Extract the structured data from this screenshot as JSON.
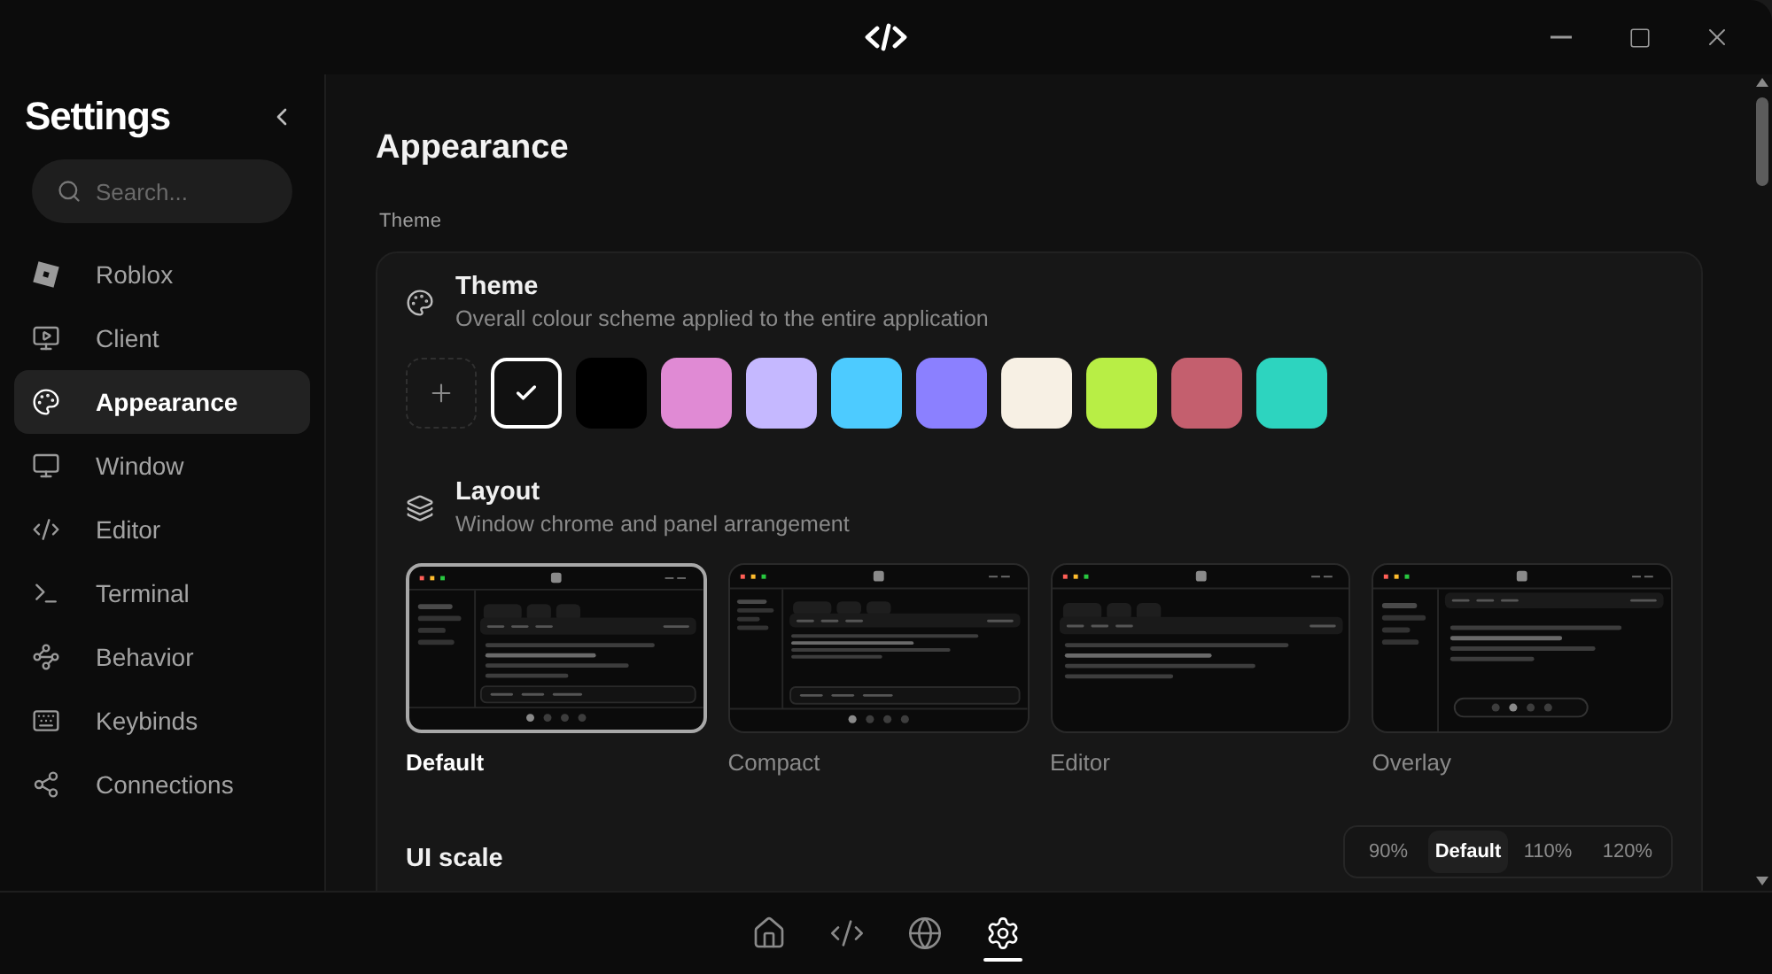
{
  "sidebar": {
    "title": "Settings",
    "search": {
      "placeholder": "Search..."
    },
    "items": [
      {
        "label": "Roblox",
        "selected": false
      },
      {
        "label": "Client",
        "selected": false
      },
      {
        "label": "Appearance",
        "selected": true
      },
      {
        "label": "Window",
        "selected": false
      },
      {
        "label": "Editor",
        "selected": false
      },
      {
        "label": "Terminal",
        "selected": false
      },
      {
        "label": "Behavior",
        "selected": false
      },
      {
        "label": "Keybinds",
        "selected": false
      },
      {
        "label": "Connections",
        "selected": false
      }
    ]
  },
  "page": {
    "title": "Appearance",
    "section_label": "Theme"
  },
  "theme": {
    "title": "Theme",
    "description": "Overall colour scheme applied to the entire application",
    "swatches": [
      {
        "color": "#111111",
        "selected": true
      },
      {
        "color": "#000000",
        "selected": false
      },
      {
        "color": "#e08ad4",
        "selected": false
      },
      {
        "color": "#c5b8ff",
        "selected": false
      },
      {
        "color": "#4dcbff",
        "selected": false
      },
      {
        "color": "#8b80ff",
        "selected": false
      },
      {
        "color": "#f7f0e4",
        "selected": false
      },
      {
        "color": "#b8ee45",
        "selected": false
      },
      {
        "color": "#c45f6e",
        "selected": false
      },
      {
        "color": "#2dd4bf",
        "selected": false
      }
    ]
  },
  "layout": {
    "title": "Layout",
    "description": "Window chrome and panel arrangement",
    "options": [
      {
        "label": "Default",
        "kind": "default",
        "selected": true
      },
      {
        "label": "Compact",
        "kind": "compact",
        "selected": false
      },
      {
        "label": "Editor",
        "kind": "editor",
        "selected": false
      },
      {
        "label": "Overlay",
        "kind": "overlay",
        "selected": false
      }
    ]
  },
  "ui_scale": {
    "title": "UI scale",
    "options": [
      {
        "label": "90%",
        "selected": false
      },
      {
        "label": "Default",
        "selected": true
      },
      {
        "label": "110%",
        "selected": false
      },
      {
        "label": "120%",
        "selected": false
      }
    ]
  },
  "bottom_nav": {
    "items": [
      {
        "selected": false
      },
      {
        "selected": false
      },
      {
        "selected": false
      },
      {
        "selected": true
      }
    ]
  }
}
